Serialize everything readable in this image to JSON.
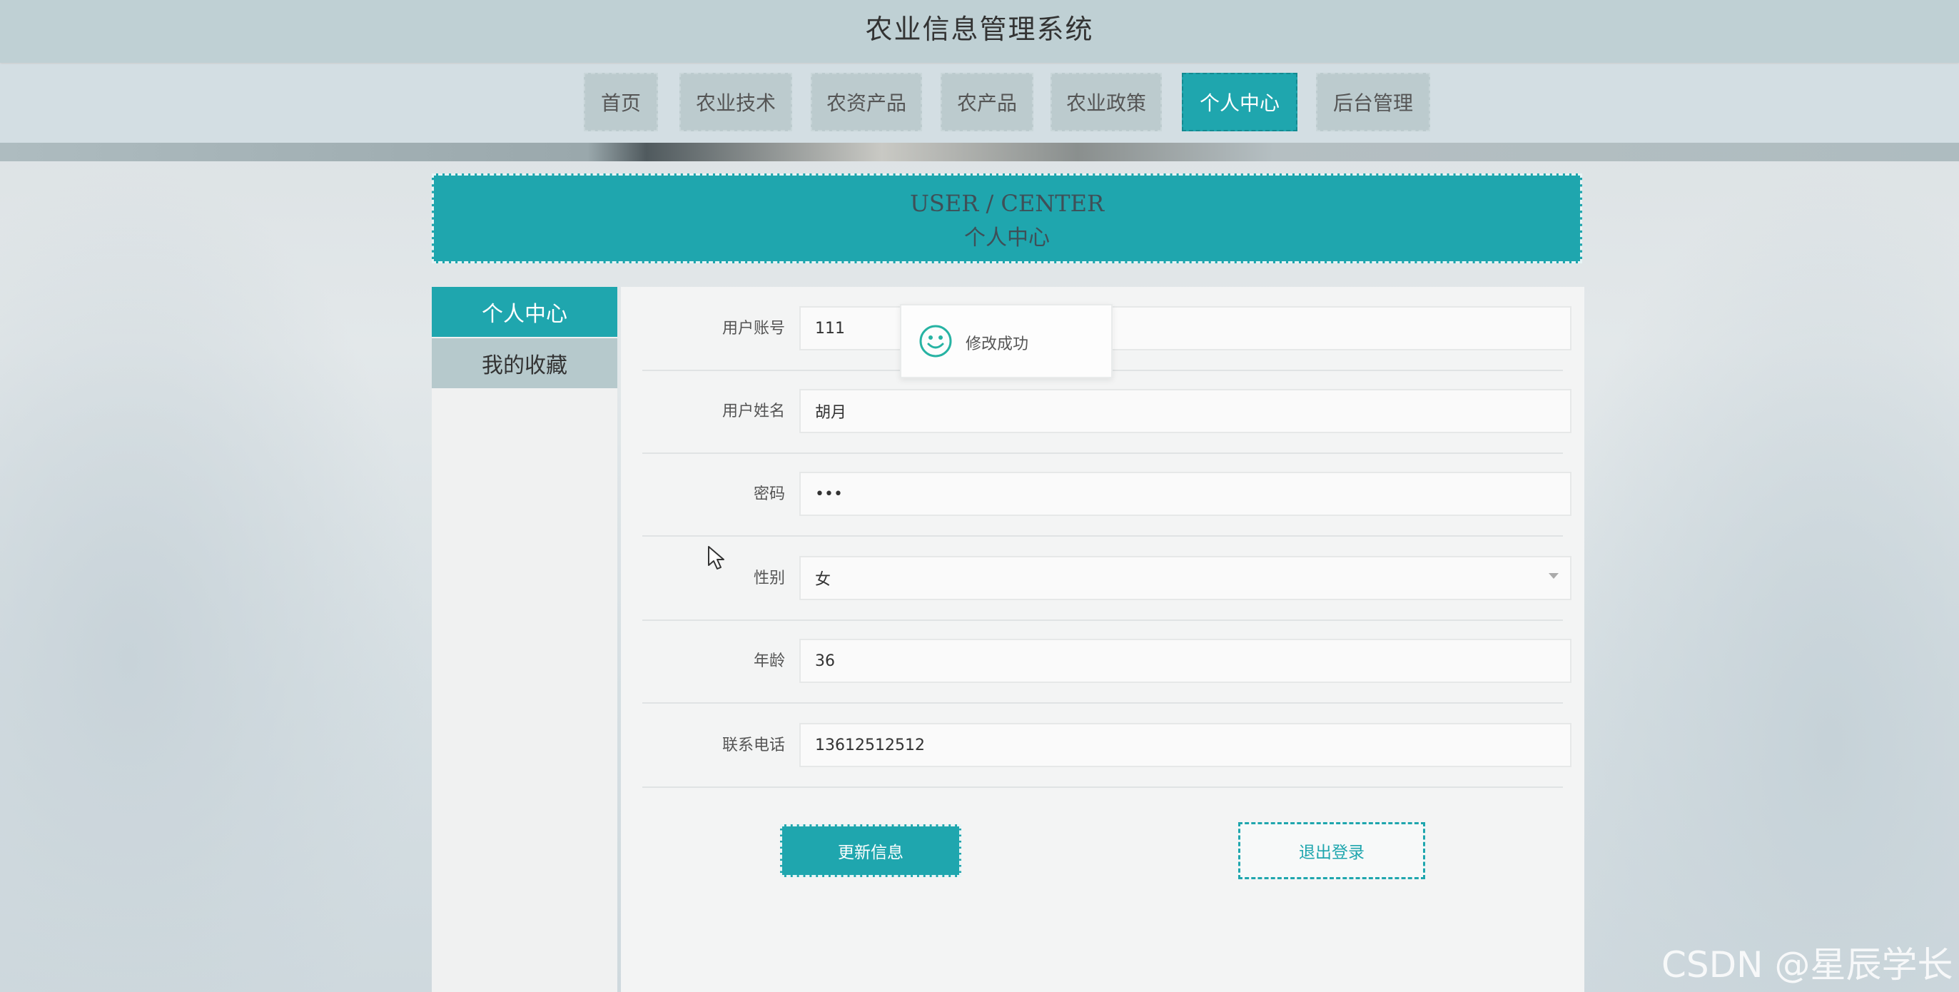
{
  "app": {
    "title": "农业信息管理系统"
  },
  "nav": [
    {
      "label": "首页",
      "active": false
    },
    {
      "label": "农业技术",
      "active": false
    },
    {
      "label": "农资产品",
      "active": false
    },
    {
      "label": "农产品",
      "active": false
    },
    {
      "label": "农业政策",
      "active": false
    },
    {
      "label": "个人中心",
      "active": true
    },
    {
      "label": "后台管理",
      "active": false
    }
  ],
  "banner": {
    "en": "USER / CENTER",
    "cn": "个人中心"
  },
  "sidebar": {
    "items": [
      {
        "label": "个人中心",
        "active": true
      },
      {
        "label": "我的收藏",
        "active": false
      }
    ]
  },
  "form": {
    "fields": [
      {
        "label": "用户账号",
        "value": "111",
        "type": "text"
      },
      {
        "label": "用户姓名",
        "value": "胡月",
        "type": "text"
      },
      {
        "label": "密码",
        "value": "•••",
        "type": "password"
      },
      {
        "label": "性别",
        "value": "女",
        "type": "select"
      },
      {
        "label": "年龄",
        "value": "36",
        "type": "text"
      },
      {
        "label": "联系电话",
        "value": "13612512512",
        "type": "text"
      }
    ],
    "update_label": "更新信息",
    "logout_label": "退出登录"
  },
  "toast": {
    "text": "修改成功",
    "icon": "smile-icon"
  },
  "watermark": "CSDN @星辰学长",
  "colors": {
    "accent": "#1fa6ae",
    "topbar": "#bfd0d4"
  }
}
